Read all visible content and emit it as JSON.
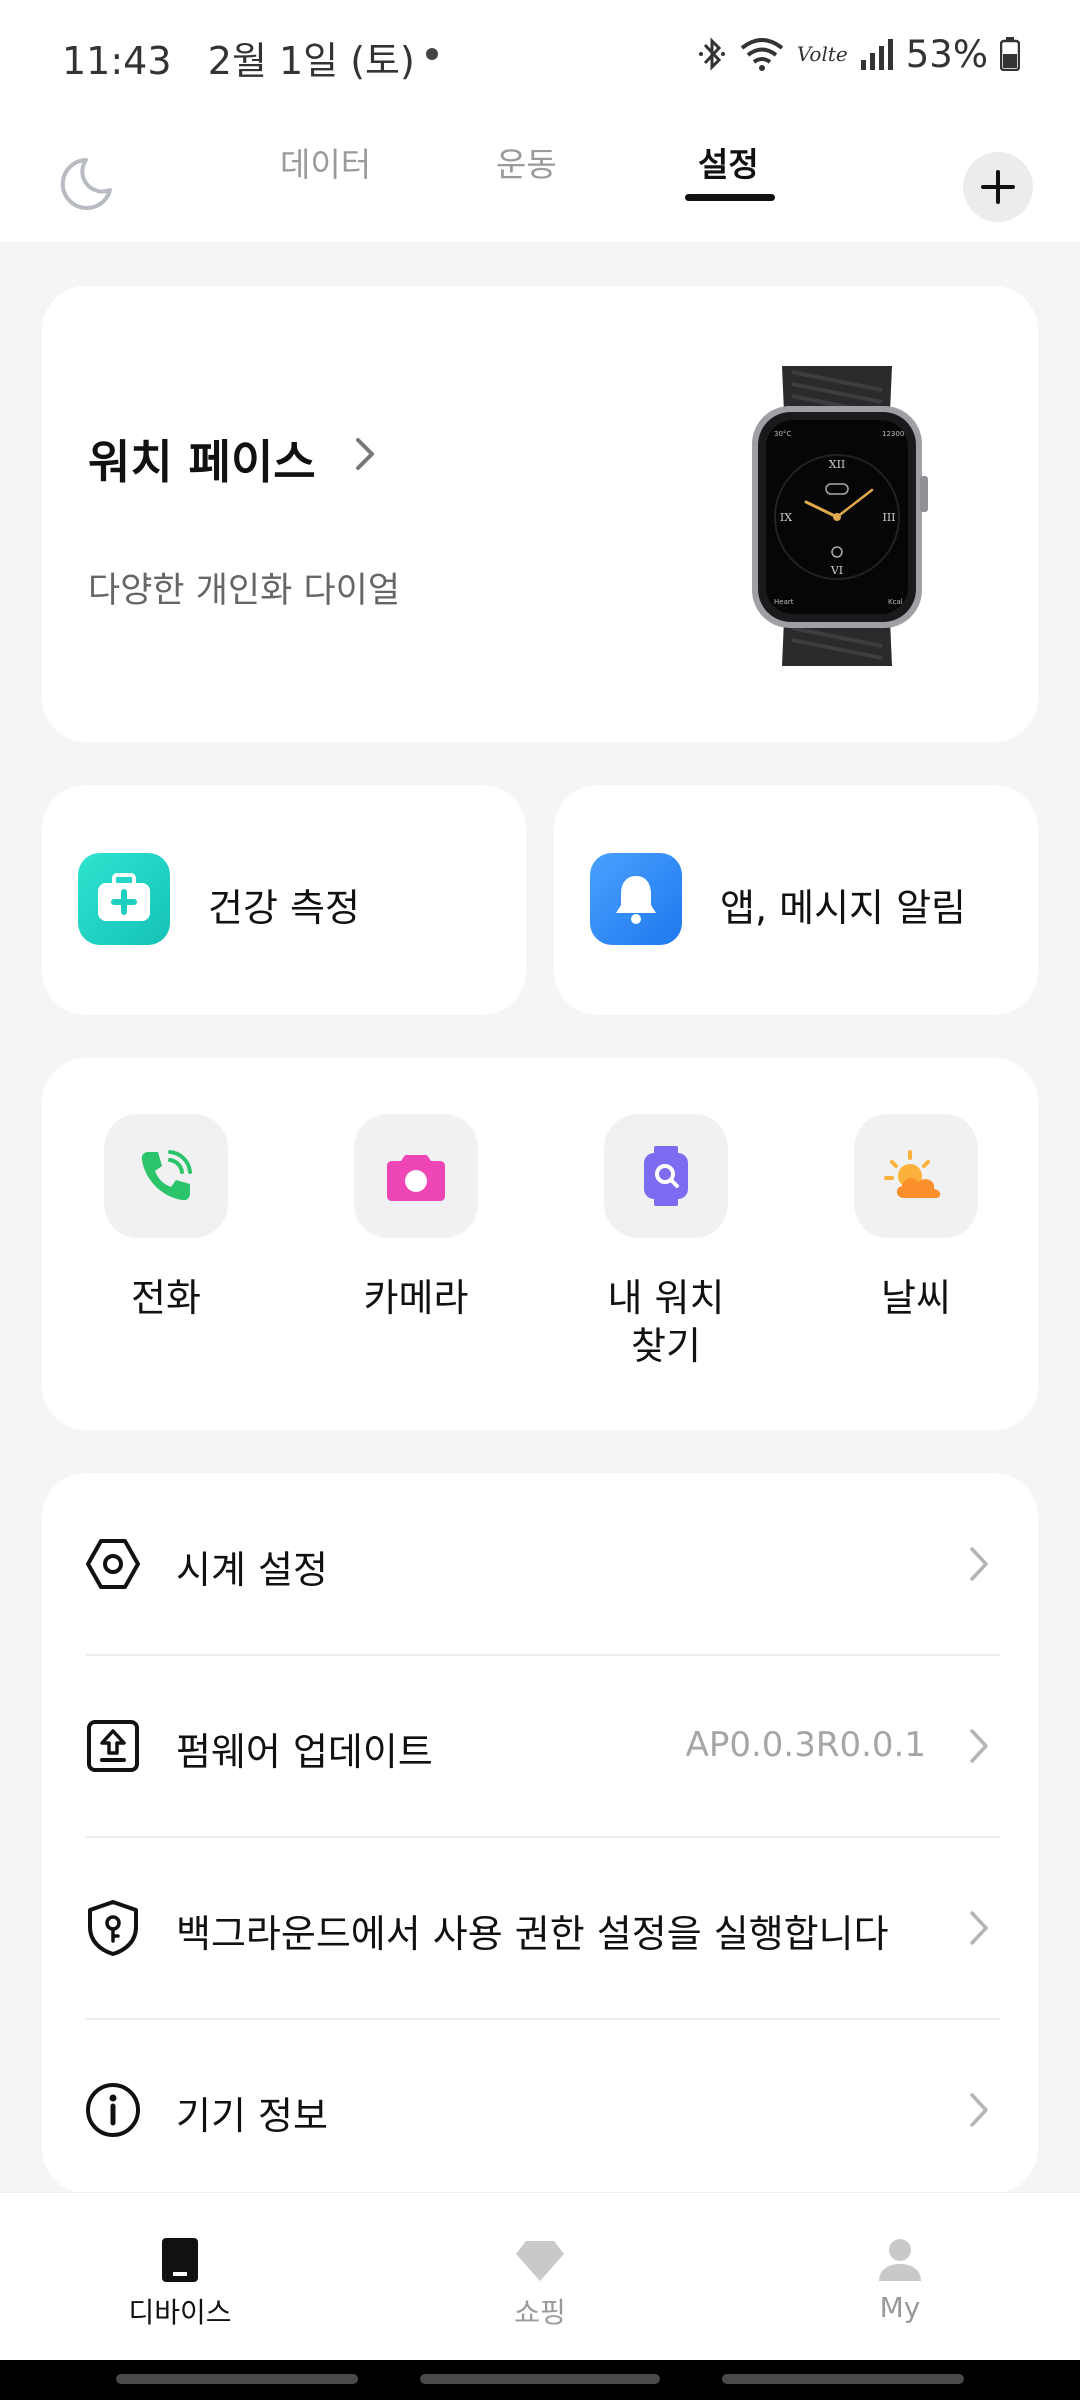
{
  "status_bar": {
    "time": "11:43",
    "date": "2월 1일 (토)",
    "battery": "53%",
    "icons": [
      "bluetooth-icon",
      "wifi-icon",
      "volte-icon",
      "signal-icon",
      "battery-icon"
    ],
    "volte_text": "Volte"
  },
  "top_nav": {
    "tabs": [
      {
        "label": "데이터",
        "active": false
      },
      {
        "label": "운동",
        "active": false
      },
      {
        "label": "설정",
        "active": true
      }
    ],
    "left_icon": "moon-icon",
    "right_icon": "plus-icon"
  },
  "watch_face": {
    "title": "워치 페이스",
    "subtitle": "다양한 개인화 다이얼",
    "image": "smartwatch-image"
  },
  "feature_cards": [
    {
      "label": "건강 측정",
      "icon": "health-kit-icon",
      "color": "#1fd1c1"
    },
    {
      "label": "앱, 메시지 알림",
      "icon": "bell-icon",
      "color": "#2f86f6"
    }
  ],
  "quick_actions": [
    {
      "label": "전화",
      "icon": "phone-icon",
      "color": "#2cc46b"
    },
    {
      "label": "카메라",
      "icon": "camera-icon",
      "color": "#ee46b4"
    },
    {
      "label": "내 워치\n찾기",
      "line1": "내 워치",
      "line2": "찾기",
      "icon": "find-watch-icon",
      "color": "#7c6cf2"
    },
    {
      "label": "날씨",
      "icon": "weather-icon",
      "color": "#fb9a2b"
    }
  ],
  "settings_list": [
    {
      "label": "시계 설정",
      "value": "",
      "icon": "hexagon-settings-icon"
    },
    {
      "label": "펌웨어 업데이트",
      "value": "AP0.0.3R0.0.1",
      "icon": "firmware-upload-icon"
    },
    {
      "label": "백그라운드에서 사용 권한 설정을 실행합니다",
      "value": "",
      "icon": "shield-key-icon"
    },
    {
      "label": "기기 정보",
      "value": "",
      "icon": "info-icon"
    }
  ],
  "bottom_nav": [
    {
      "label": "디바이스",
      "icon": "device-icon",
      "active": true
    },
    {
      "label": "쇼핑",
      "icon": "diamond-icon",
      "active": false
    },
    {
      "label": "My",
      "icon": "person-icon",
      "active": false
    }
  ]
}
